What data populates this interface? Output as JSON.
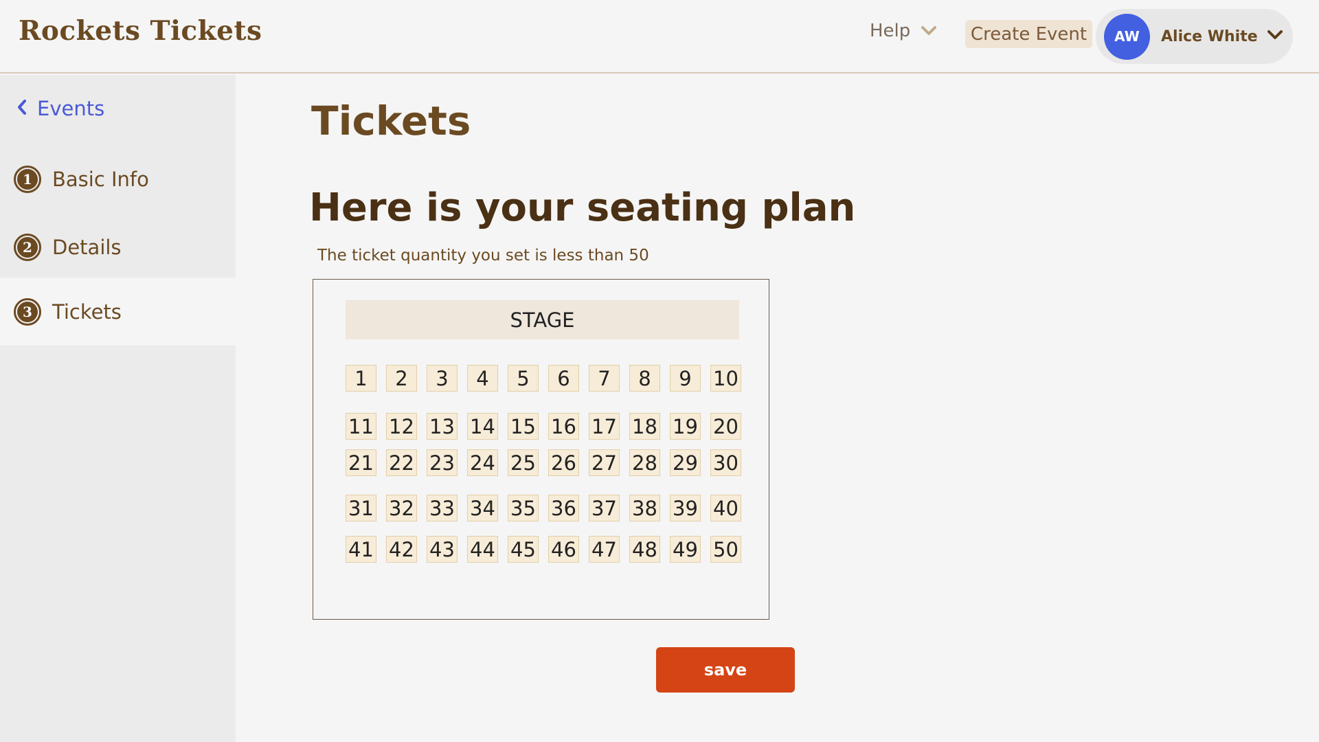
{
  "header": {
    "brand": "Rockets Tickets",
    "help_label": "Help",
    "create_event_label": "Create Event",
    "user": {
      "initials": "AW",
      "name": "Alice White"
    }
  },
  "sidebar": {
    "back_label": "Events",
    "steps": [
      {
        "number": "1",
        "label": "Basic Info",
        "active": false
      },
      {
        "number": "2",
        "label": "Details",
        "active": false
      },
      {
        "number": "3",
        "label": "Tickets",
        "active": true
      }
    ]
  },
  "main": {
    "page_title": "Tickets",
    "section_title": "Here is your seating plan",
    "subtitle": "The ticket quantity you set is less than 50",
    "stage_label": "STAGE",
    "seat_rows": [
      [
        "1",
        "2",
        "3",
        "4",
        "5",
        "6",
        "7",
        "8",
        "9",
        "10"
      ],
      [
        "11",
        "12",
        "13",
        "14",
        "15",
        "16",
        "17",
        "18",
        "19",
        "20"
      ],
      [
        "21",
        "22",
        "23",
        "24",
        "25",
        "26",
        "27",
        "28",
        "29",
        "30"
      ],
      [
        "31",
        "32",
        "33",
        "34",
        "35",
        "36",
        "37",
        "38",
        "39",
        "40"
      ],
      [
        "41",
        "42",
        "43",
        "44",
        "45",
        "46",
        "47",
        "48",
        "49",
        "50"
      ]
    ],
    "save_label": "save"
  },
  "colors": {
    "brand": "#6b4a22",
    "accent_blue": "#4260e0",
    "save": "#d44415",
    "seat_fill": "#f7ecd8",
    "stage_fill": "#efe6dc"
  }
}
